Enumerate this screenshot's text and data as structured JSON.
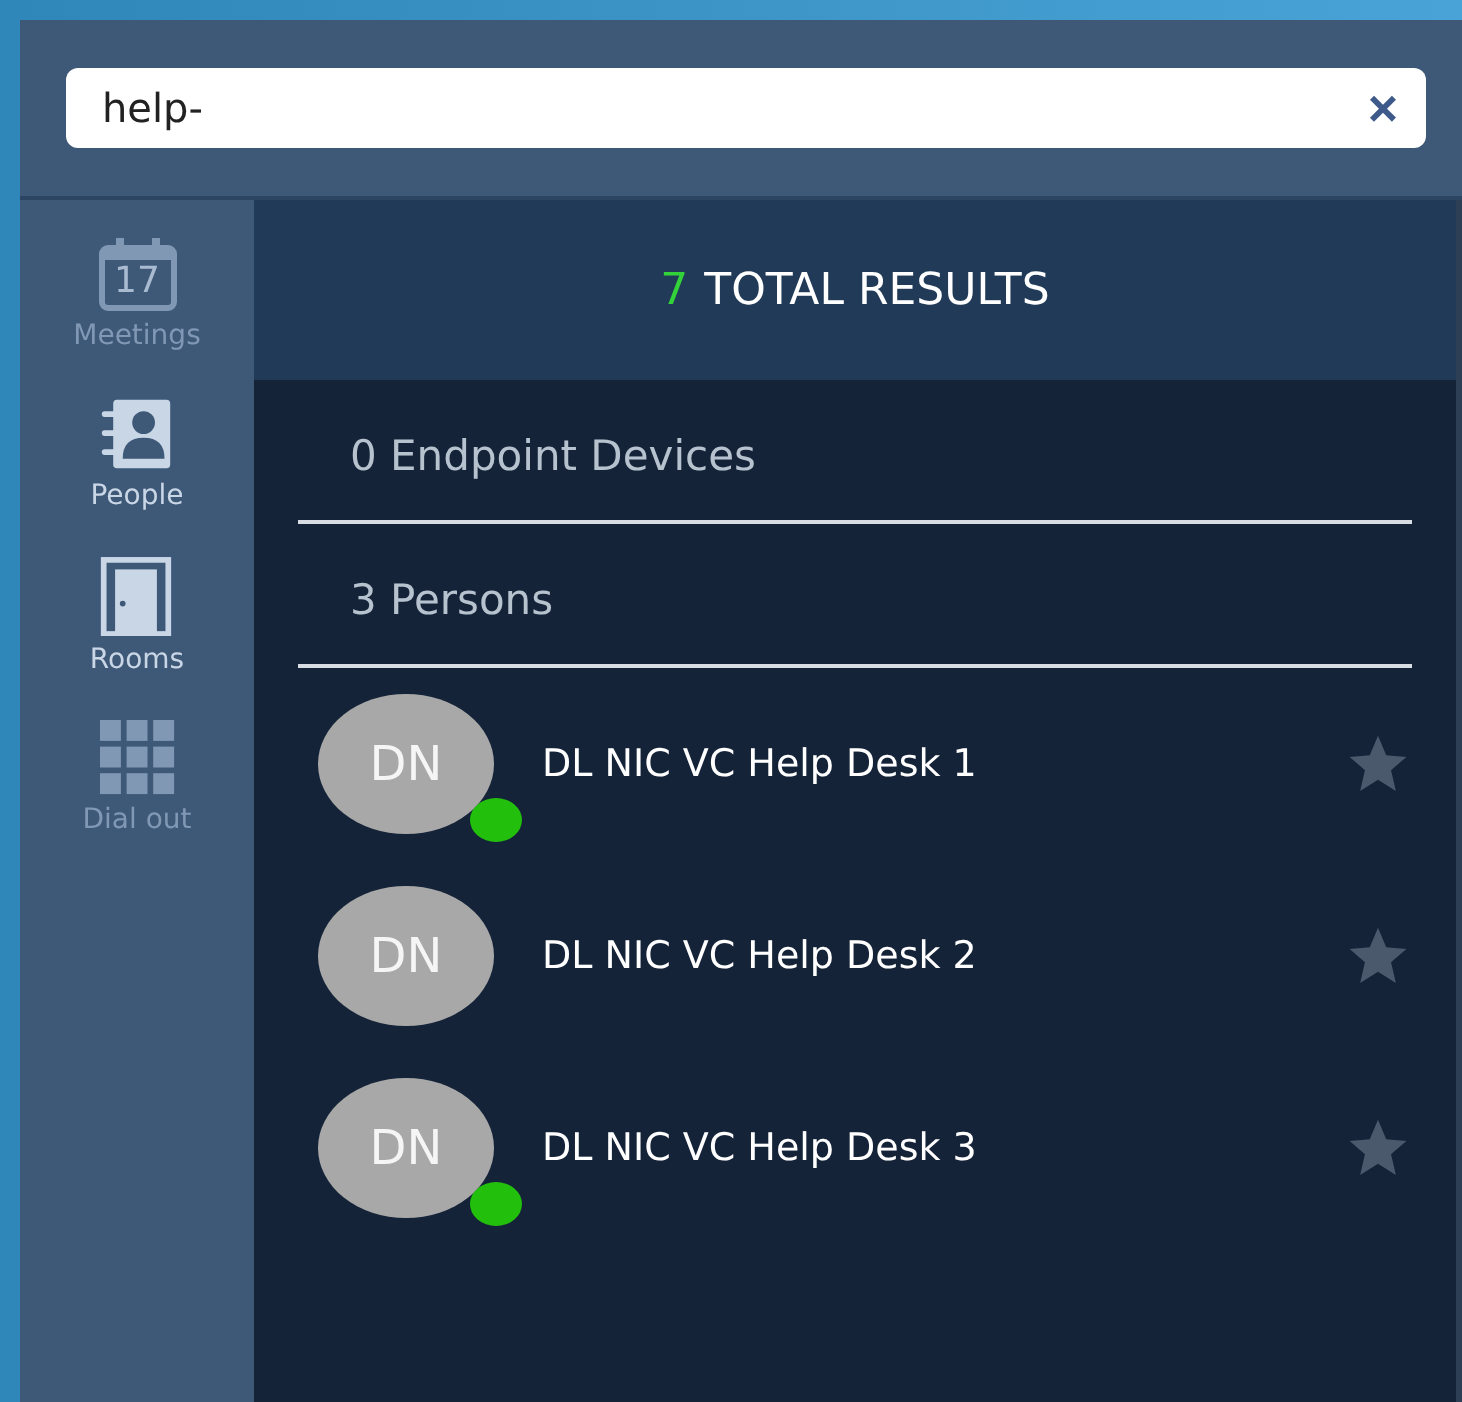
{
  "search": {
    "value": "help-",
    "clear_label": "×"
  },
  "sidebar": {
    "items": [
      {
        "kind": "meetings",
        "label": "Meetings",
        "day": "17",
        "disabled": true
      },
      {
        "kind": "people",
        "label": "People",
        "disabled": false
      },
      {
        "kind": "rooms",
        "label": "Rooms",
        "disabled": false
      },
      {
        "kind": "dialpad",
        "label": "Dial out",
        "disabled": true
      }
    ]
  },
  "results": {
    "count": "7",
    "label": "TOTAL RESULTS"
  },
  "sections": [
    {
      "title": "0 Endpoint Devices"
    },
    {
      "title": "3 Persons"
    }
  ],
  "persons": [
    {
      "initials": "DN",
      "name": "DL NIC VC Help Desk 1",
      "online": true,
      "favorite": false
    },
    {
      "initials": "DN",
      "name": "DL NIC VC Help Desk 2",
      "online": false,
      "favorite": false
    },
    {
      "initials": "DN",
      "name": "DL NIC VC Help Desk 3",
      "online": true,
      "favorite": false
    }
  ]
}
